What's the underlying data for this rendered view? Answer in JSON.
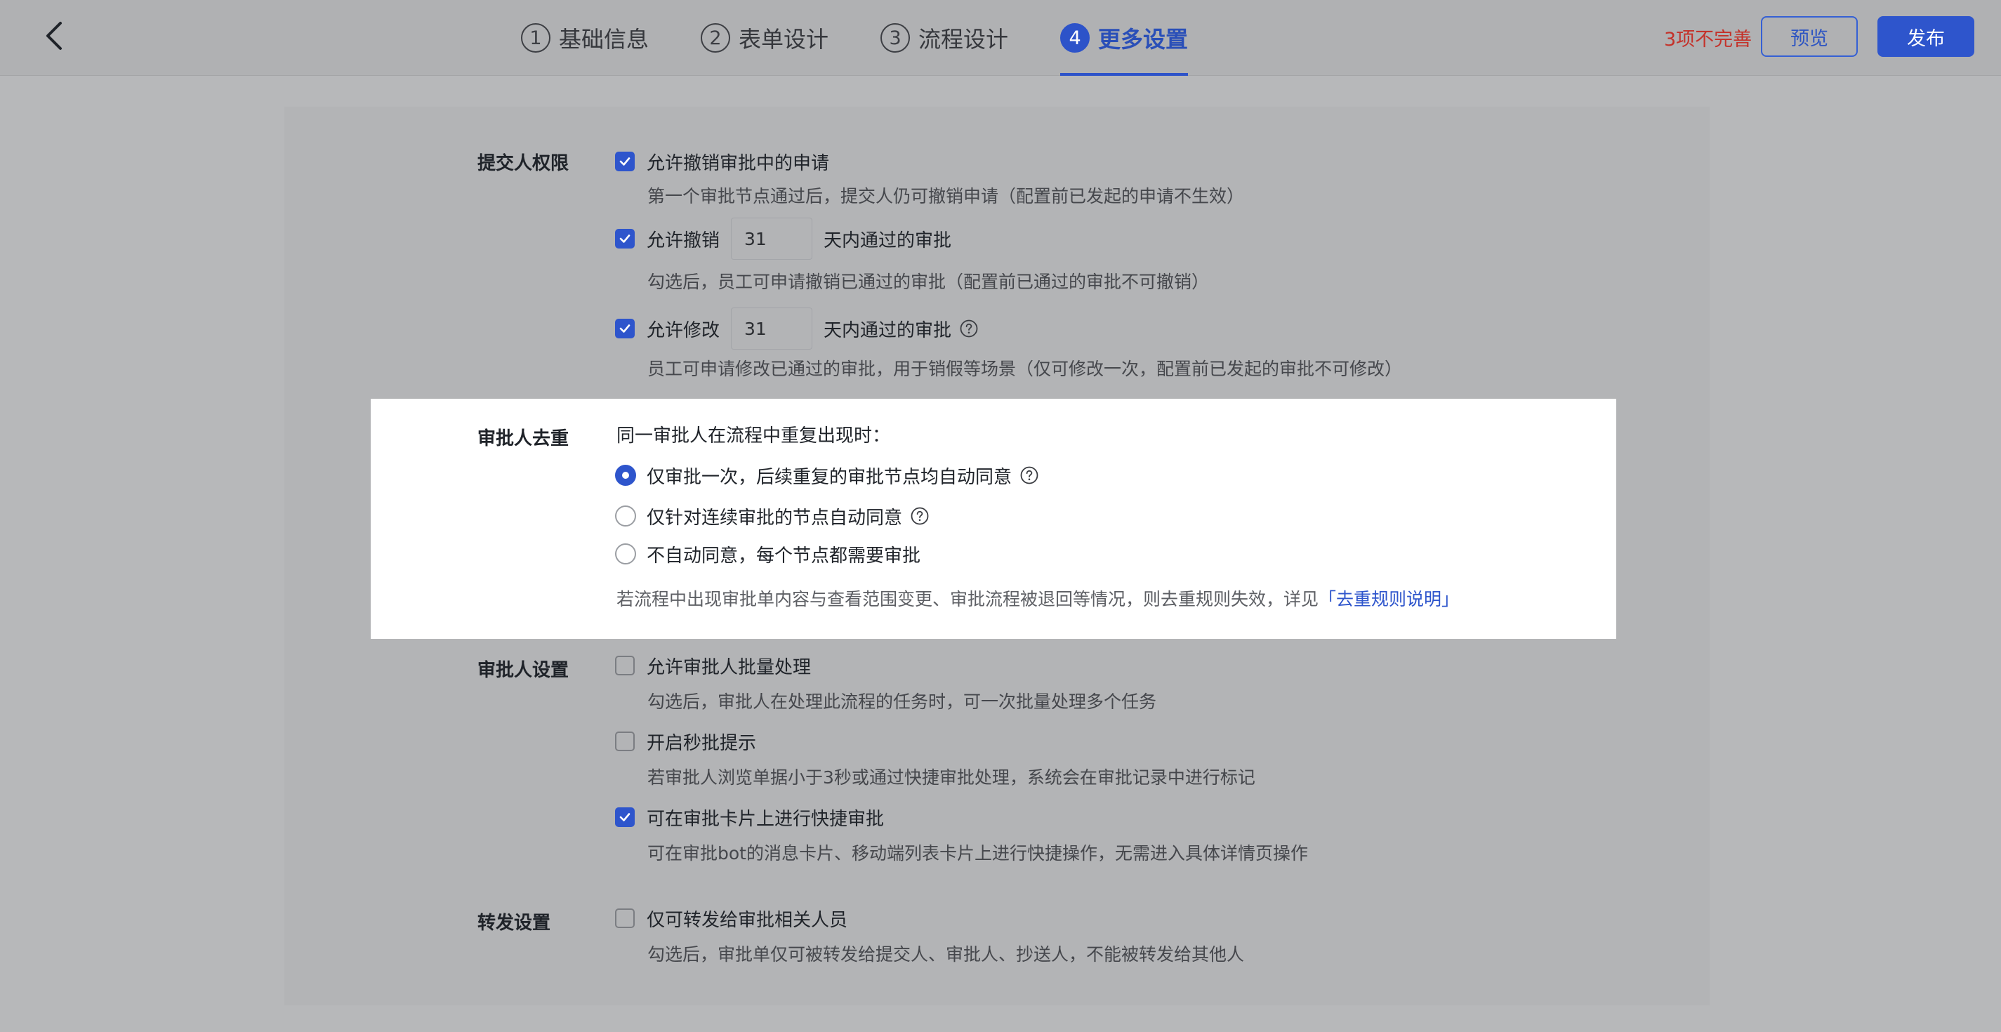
{
  "header": {
    "steps": [
      {
        "num": "1",
        "label": "基础信息"
      },
      {
        "num": "2",
        "label": "表单设计"
      },
      {
        "num": "3",
        "label": "流程设计"
      },
      {
        "num": "4",
        "label": "更多设置"
      }
    ],
    "active_step": 4,
    "warning": "3项不完善",
    "preview_label": "预览",
    "publish_label": "发布"
  },
  "submitter": {
    "label": "提交人权限",
    "opt1": {
      "text": "允许撤销审批中的申请",
      "checked": true,
      "desc": "第一个审批节点通过后，提交人仍可撤销申请（配置前已发起的申请不生效）"
    },
    "opt2": {
      "pre": "允许撤销",
      "value": "31",
      "post": "天内通过的审批",
      "checked": true,
      "desc": "勾选后，员工可申请撤销已通过的审批（配置前已通过的审批不可撤销）"
    },
    "opt3": {
      "pre": "允许修改",
      "value": "31",
      "post": "天内通过的审批",
      "checked": true,
      "desc": "员工可申请修改已通过的审批，用于销假等场景（仅可修改一次，配置前已发起的审批不可修改）"
    }
  },
  "dedupe": {
    "label": "审批人去重",
    "title": "同一审批人在流程中重复出现时：",
    "options": [
      {
        "text": "仅审批一次，后续重复的审批节点均自动同意",
        "selected": true
      },
      {
        "text": "仅针对连续审批的节点自动同意",
        "selected": false
      },
      {
        "text": "不自动同意，每个节点都需要审批",
        "selected": false
      }
    ],
    "note": "若流程中出现审批单内容与查看范围变更、审批流程被退回等情况，则去重规则失效，详见",
    "link": "「去重规则说明」"
  },
  "approver": {
    "label": "审批人设置",
    "opt1": {
      "text": "允许审批人批量处理",
      "checked": false,
      "desc": "勾选后，审批人在处理此流程的任务时，可一次批量处理多个任务"
    },
    "opt2": {
      "text": "开启秒批提示",
      "checked": false,
      "desc": "若审批人浏览单据小于3秒或通过快捷审批处理，系统会在审批记录中进行标记"
    },
    "opt3": {
      "text": "可在审批卡片上进行快捷审批",
      "checked": true,
      "desc": "可在审批bot的消息卡片、移动端列表卡片上进行快捷操作，无需进入具体详情页操作"
    }
  },
  "forward": {
    "label": "转发设置",
    "opt1": {
      "text": "仅可转发给审批相关人员",
      "checked": false,
      "desc": "勾选后，审批单仅可被转发给提交人、审批人、抄送人，不能被转发给其他人"
    }
  }
}
